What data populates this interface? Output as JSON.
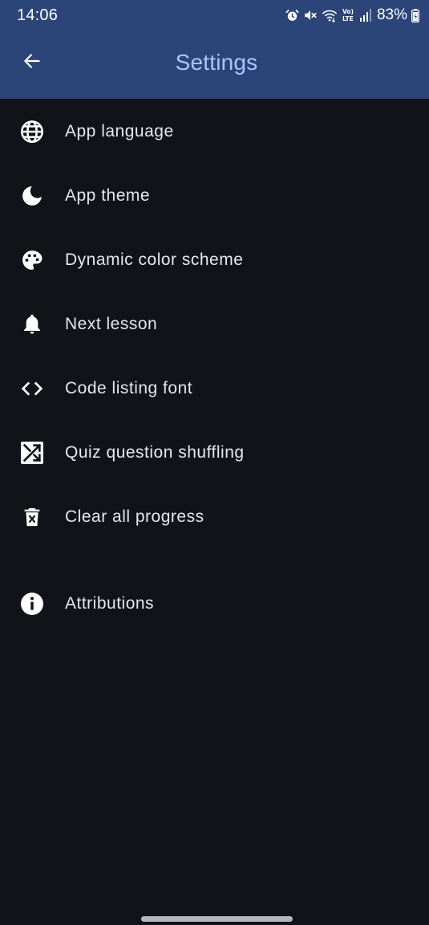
{
  "status_bar": {
    "time": "14:06",
    "battery": "83%",
    "icons": [
      "alarm-icon",
      "mute-icon",
      "wifi-icon",
      "volte-icon",
      "signal-icon",
      "battery-icon"
    ]
  },
  "header": {
    "title": "Settings",
    "back_icon": "arrow-back-icon"
  },
  "settings": {
    "items": [
      {
        "label": "App language",
        "icon": "globe-icon"
      },
      {
        "label": "App theme",
        "icon": "moon-icon"
      },
      {
        "label": "Dynamic color scheme",
        "icon": "palette-icon"
      },
      {
        "label": "Next lesson",
        "icon": "bell-icon"
      },
      {
        "label": "Code listing font",
        "icon": "code-icon"
      },
      {
        "label": "Quiz question shuffling",
        "icon": "shuffle-icon"
      },
      {
        "label": "Clear all progress",
        "icon": "delete-icon"
      },
      {
        "label": "Attributions",
        "icon": "info-icon"
      }
    ]
  },
  "colors": {
    "app_bar": "#2b4579",
    "title": "#a9c7ff",
    "background": "#121318",
    "text": "#e7e6ee"
  }
}
